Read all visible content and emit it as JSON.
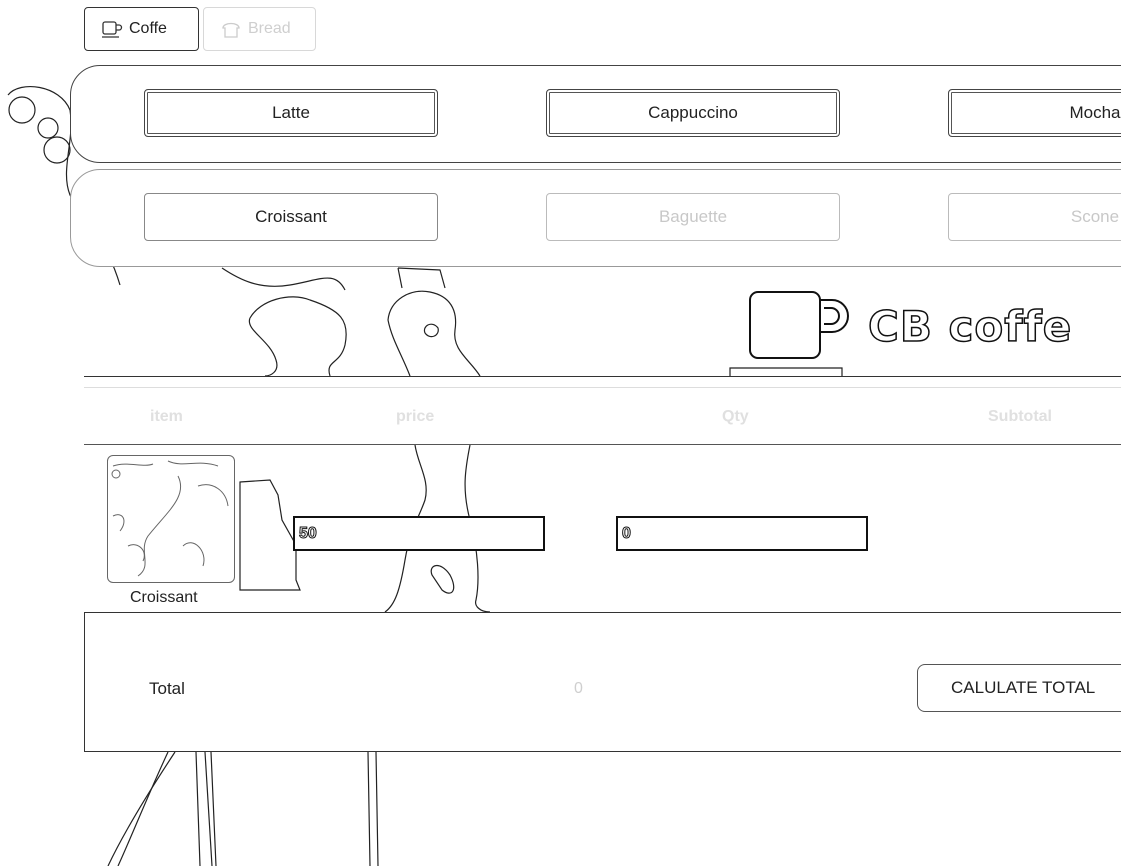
{
  "tabs": [
    {
      "label": "Coffe",
      "icon": "cup-icon",
      "active": true
    },
    {
      "label": "Bread",
      "icon": "bread-icon",
      "active": false
    }
  ],
  "coffee_products": [
    "Latte",
    "Cappuccino",
    "Mocha"
  ],
  "bread_products": [
    "Croissant",
    "Baguette",
    "Scone"
  ],
  "brand": {
    "title": "CB coffe",
    "icon": "coffee-cup-icon"
  },
  "table": {
    "headers": {
      "item": "item",
      "price": "price",
      "qty": "Qty",
      "subtotal": "Subtotal"
    },
    "row": {
      "name": "Croissant",
      "price": "50",
      "qty": "0"
    }
  },
  "total": {
    "label": "Total",
    "value": "0",
    "button": "CALULATE TOTAL"
  }
}
